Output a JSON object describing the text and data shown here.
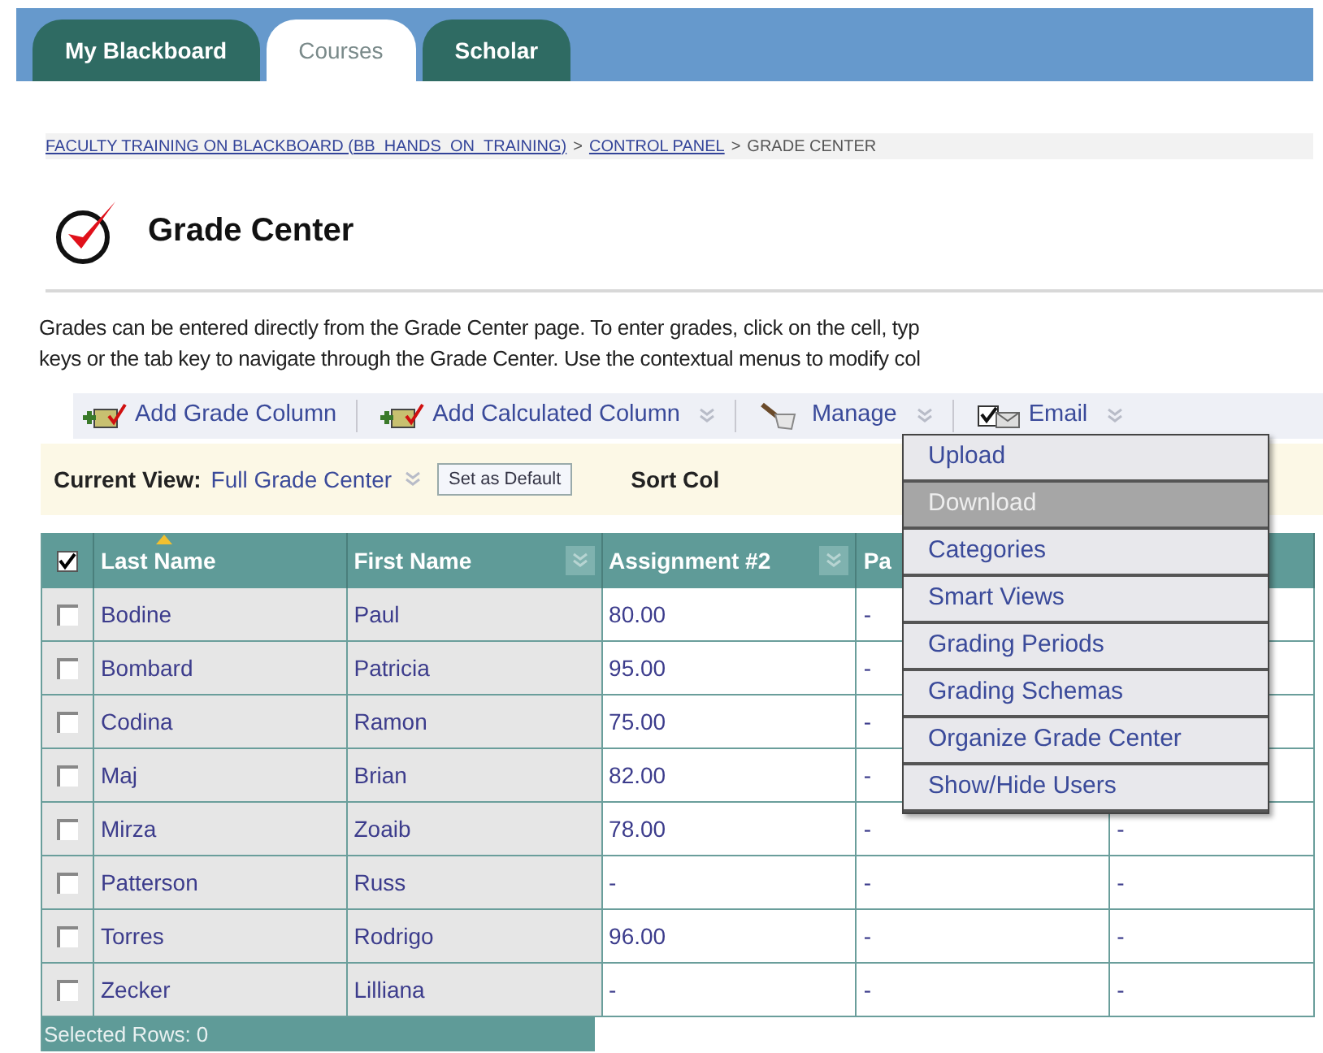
{
  "tabs": [
    {
      "label": "My Blackboard",
      "selected": false
    },
    {
      "label": "Courses",
      "selected": true
    },
    {
      "label": "Scholar",
      "selected": false
    }
  ],
  "breadcrumb": [
    {
      "label": "FACULTY TRAINING ON BLACKBOARD (BB_HANDS_ON_TRAINING)",
      "link": true
    },
    {
      "label": "CONTROL PANEL",
      "link": true,
      "separator": ">"
    },
    {
      "label": "GRADE CENTER",
      "link": false,
      "separator": ">"
    }
  ],
  "page_title": "Grade Center",
  "instructions": [
    "Grades can be entered directly from the Grade Center page. To enter grades, click on the cell, typ",
    "keys or the tab key to navigate through the Grade Center. Use the contextual menus to modify col"
  ],
  "toolbar": [
    {
      "label": "Add Grade Column",
      "kind": "add",
      "menu": false
    },
    {
      "label": "Add Calculated Column",
      "kind": "add",
      "menu": true
    },
    {
      "label": "Manage",
      "kind": "manage",
      "menu": true
    },
    {
      "label": "Email",
      "kind": "email",
      "menu": true
    }
  ],
  "view_bar": {
    "label": "Current View:",
    "value": "Full Grade Center",
    "button": "Set as Default",
    "sort_label": "Sort Col"
  },
  "table": {
    "select_all_checked": true,
    "columns": [
      {
        "label": "Last Name",
        "sorted": true,
        "menu": false
      },
      {
        "label": "First Name",
        "sorted": false,
        "menu": true
      },
      {
        "label": "Assignment #2",
        "sorted": false,
        "menu": true
      },
      {
        "label": "Pa"
      }
    ],
    "rows": [
      {
        "checked": false,
        "cells": [
          "Bodine",
          "Paul",
          "80.00",
          "-"
        ]
      },
      {
        "checked": false,
        "cells": [
          "Bombard",
          "Patricia",
          "95.00",
          "-"
        ]
      },
      {
        "checked": false,
        "cells": [
          "Codina",
          "Ramon",
          "75.00",
          "-"
        ]
      },
      {
        "checked": false,
        "cells": [
          "Maj",
          "Brian",
          "82.00",
          "-"
        ]
      },
      {
        "checked": false,
        "cells": [
          "Mirza",
          "Zoaib",
          "78.00",
          "-",
          "-"
        ]
      },
      {
        "checked": false,
        "cells": [
          "Patterson",
          "Russ",
          "-",
          "-",
          "-"
        ]
      },
      {
        "checked": false,
        "cells": [
          "Torres",
          "Rodrigo",
          "96.00",
          "-",
          "-"
        ]
      },
      {
        "checked": false,
        "cells": [
          "Zecker",
          "Lilliana",
          "-",
          "-",
          "-"
        ]
      }
    ],
    "footer": "Selected Rows: 0"
  },
  "manage_menu": [
    {
      "label": "Upload",
      "selected": false
    },
    {
      "label": "Download",
      "selected": true
    },
    {
      "label": "Categories",
      "selected": false
    },
    {
      "label": "Smart Views",
      "selected": false
    },
    {
      "label": "Grading Periods",
      "selected": false
    },
    {
      "label": "Grading Schemas",
      "selected": false
    },
    {
      "label": "Organize Grade Center",
      "selected": false
    },
    {
      "label": "Show/Hide Users",
      "selected": false
    }
  ]
}
